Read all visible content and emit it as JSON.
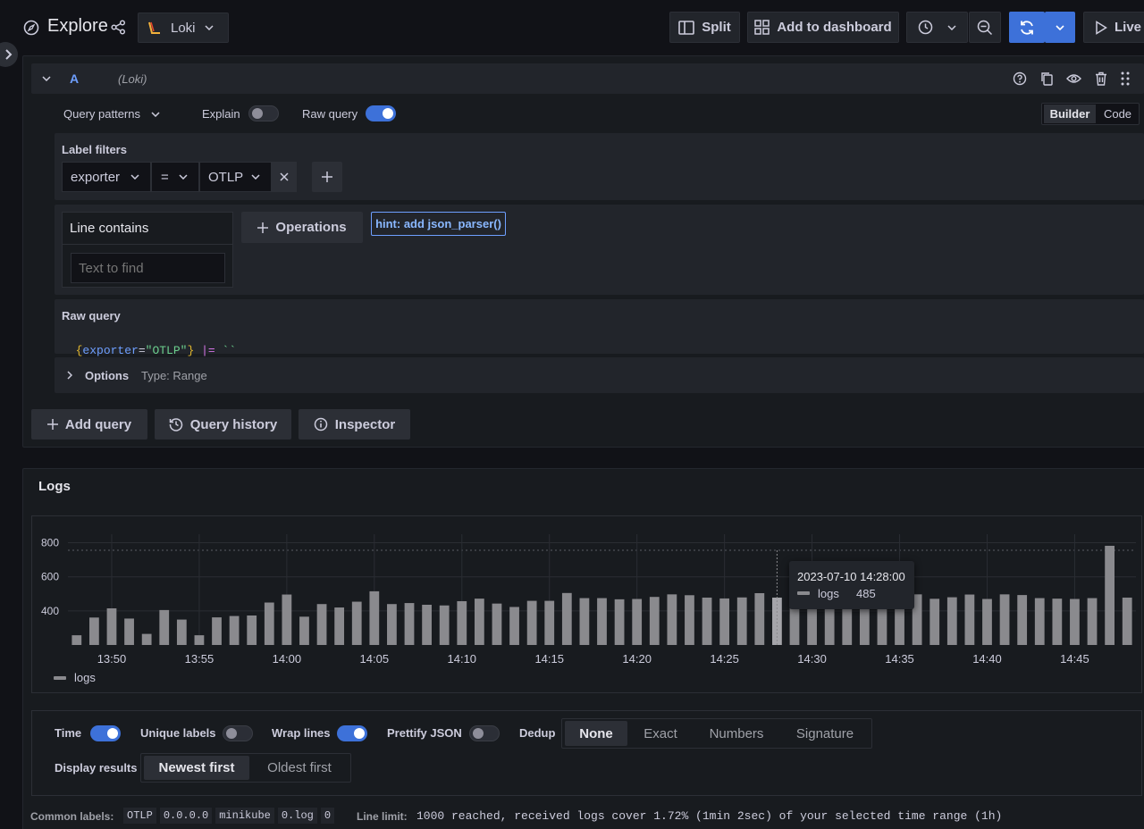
{
  "header": {
    "title": "Explore",
    "datasource": "Loki",
    "split_label": "Split",
    "add_dashboard_label": "Add to dashboard",
    "live_label": "Live"
  },
  "query": {
    "ref_id": "A",
    "ds_name": "(Loki)",
    "patterns_label": "Query patterns",
    "explain_label": "Explain",
    "raw_query_label": "Raw query",
    "mode_builder": "Builder",
    "mode_code": "Code",
    "label_filters_title": "Label filters",
    "filter_label": "exporter",
    "filter_op": "=",
    "filter_value": "OTLP",
    "line_contains_title": "Line contains",
    "text_placeholder": "Text to find",
    "operations_label": "Operations",
    "hint_label": "hint: add json_parser()",
    "raw_query_title": "Raw query",
    "raw_tokens": {
      "brace_open": "{",
      "key": "exporter",
      "eq": "=",
      "value": "\"OTLP\"",
      "brace_close": "}",
      "pipe": "|=",
      "ticks": "``"
    },
    "options_label": "Options",
    "options_type": "Type: Range"
  },
  "actions": {
    "add_query": "Add query",
    "query_history": "Query history",
    "inspector": "Inspector"
  },
  "logs": {
    "title": "Logs",
    "tooltip_time": "2023-07-10 14:28:00",
    "tooltip_series": "logs",
    "tooltip_value": "485",
    "legend": "logs"
  },
  "chart_data": {
    "type": "bar",
    "title": "",
    "x_ticks": [
      "13:50",
      "13:55",
      "14:00",
      "14:05",
      "14:10",
      "14:15",
      "14:20",
      "14:25",
      "14:30",
      "14:35",
      "14:40",
      "14:45"
    ],
    "y_ticks": [
      "400",
      "600",
      "800"
    ],
    "series": [
      {
        "name": "logs",
        "values": [
          257,
          361,
          415,
          355,
          265,
          405,
          349,
          257,
          362,
          370,
          373,
          449,
          496,
          366,
          440,
          420,
          454,
          515,
          440,
          446,
          436,
          432,
          457,
          472,
          443,
          423,
          459,
          459,
          505,
          475,
          475,
          468,
          470,
          482,
          497,
          492,
          478,
          473,
          479,
          504,
          478,
          485,
          479,
          479,
          478,
          487,
          480,
          476,
          497,
          471,
          480,
          496,
          470,
          497,
          493,
          475,
          472,
          470,
          475,
          782,
          478
        ]
      }
    ],
    "ylim": [
      200,
      850
    ],
    "colors": {
      "bar": "#8a8a8e",
      "highlight": "#a5a5aa"
    }
  },
  "controls": {
    "time": "Time",
    "unique_labels": "Unique labels",
    "wrap_lines": "Wrap lines",
    "prettify_json": "Prettify JSON",
    "dedup": "Dedup",
    "dedup_options": [
      "None",
      "Exact",
      "Numbers",
      "Signature"
    ],
    "display_results": "Display results",
    "order_options": [
      "Newest first",
      "Oldest first"
    ]
  },
  "footer": {
    "common_labels_label": "Common labels:",
    "common_labels": [
      "OTLP",
      "0.0.0.0",
      "minikube",
      "0.log",
      "0"
    ],
    "line_limit_label": "Line limit:",
    "line_limit_text": "1000 reached, received logs cover 1.72% (1min 2sec) of your selected time range (1h)"
  }
}
